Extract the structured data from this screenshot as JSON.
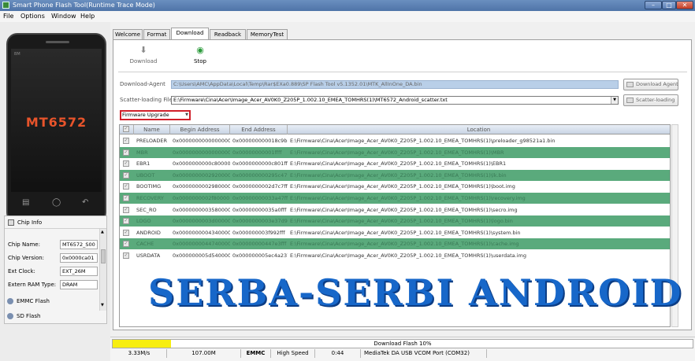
{
  "window": {
    "title": "Smart Phone Flash Tool(Runtime Trace Mode)"
  },
  "menu": [
    "File",
    "Options",
    "Window",
    "Help"
  ],
  "phone": {
    "brand": "BM",
    "chip": "MT6572"
  },
  "chip_info": {
    "title": "Chip Info",
    "rows": [
      {
        "label": "Chip Name:",
        "value": "MT6572_S00"
      },
      {
        "label": "Chip Version:",
        "value": "0x0000ca01"
      },
      {
        "label": "Ext Clock:",
        "value": "EXT_26M"
      },
      {
        "label": "Extern RAM Type:",
        "value": "DRAM"
      }
    ]
  },
  "side_sections": [
    "EMMC Flash",
    "SD Flash"
  ],
  "tabs": [
    "Welcome",
    "Format",
    "Download",
    "Readback",
    "MemoryTest"
  ],
  "toolbar": {
    "download": "Download",
    "stop": "Stop"
  },
  "download_agent": {
    "label": "Download-Agent",
    "value": "C:\\Users\\AMC\\AppData\\Local\\Temp\\Rar$EXa0.889\\SP Flash Tool v5.1352.01\\MTK_AllInOne_DA.bin",
    "button": "Download Agent"
  },
  "scatter": {
    "label": "Scatter-loading File",
    "value": "E:\\Firmware\\Cina\\Acer\\Image_Acer_AV0K0_Z205P_1.002.10_EMEA_TOMHRS(1)\\MT6572_Android_scatter.txt",
    "button": "Scatter-loading"
  },
  "mode": "Firmware Upgrade",
  "grid": {
    "headers": [
      "Name",
      "Begin Address",
      "End Address",
      "Location"
    ],
    "rows": [
      [
        "PRELOADER",
        "0x0000000000000000",
        "0x000000000018c9b",
        "E:\\Firmware\\Cina\\Acer\\Image_Acer_AV0K0_Z205P_1.002.10_EMEA_TOMHRS(1)\\preloader_g98521a1.bin"
      ],
      [
        "MBR",
        "0x0000000000000000",
        "0x00000000001ffff",
        "E:\\Firmware\\Cina\\Acer\\Image_Acer_AV0K0_Z205P_1.002.10_EMEA_TOMHRS(1)\\MBR"
      ],
      [
        "EBR1",
        "0x0000000000c80000",
        "0x0000000000c801ff",
        "E:\\Firmware\\Cina\\Acer\\Image_Acer_AV0K0_Z205P_1.002.10_EMEA_TOMHRS(1)\\EBR1"
      ],
      [
        "UBOOT",
        "0x0000000002920000",
        "0x000000000295c47f",
        "E:\\Firmware\\Cina\\Acer\\Image_Acer_AV0K0_Z205P_1.002.10_EMEA_TOMHRS(1)\\lk.bin"
      ],
      [
        "BOOTIMG",
        "0x0000000002980000",
        "0x0000000002d7c7ff",
        "E:\\Firmware\\Cina\\Acer\\Image_Acer_AV0K0_Z205P_1.002.10_EMEA_TOMHRS(1)\\boot.img"
      ],
      [
        "RECOVERY",
        "0x0000000002f80000",
        "0x00000000033a47ff",
        "E:\\Firmware\\Cina\\Acer\\Image_Acer_AV0K0_Z205P_1.002.10_EMEA_TOMHRS(1)\\recovery.img"
      ],
      [
        "SEC_RO",
        "0x0000000003580000",
        "0x00000000035a0fff",
        "E:\\Firmware\\Cina\\Acer\\Image_Acer_AV0K0_Z205P_1.002.10_EMEA_TOMHRS(1)\\secro.img"
      ],
      [
        "LOGO",
        "0x0000000003d00000",
        "0x0000000003e37d9f",
        "E:\\Firmware\\Cina\\Acer\\Image_Acer_AV0K0_Z205P_1.002.10_EMEA_TOMHRS(1)\\logo.bin"
      ],
      [
        "ANDROID",
        "0x0000000004340000",
        "0x000000003f992fff",
        "E:\\Firmware\\Cina\\Acer\\Image_Acer_AV0K0_Z205P_1.002.10_EMEA_TOMHRS(1)\\system.bin"
      ],
      [
        "CACHE",
        "0x0000000044740000",
        "0x00000000447e3fff",
        "E:\\Firmware\\Cina\\Acer\\Image_Acer_AV0K0_Z205P_1.002.10_EMEA_TOMHRS(1)\\cache.img"
      ],
      [
        "USRDATA",
        "0x000000005d540000",
        "0x000000005ec4a237",
        "E:\\Firmware\\Cina\\Acer\\Image_Acer_AV0K0_Z205P_1.002.10_EMEA_TOMHRS(1)\\userdata.img"
      ]
    ]
  },
  "watermark": "SERBA-SERBI ANDROID",
  "status": {
    "progress_label": "Download Flash 10%",
    "progress": 0.1,
    "speed": "3.33M/s",
    "size": "107.00M",
    "storage": "EMMC",
    "mode": "High Speed",
    "time": "0:44",
    "port": "MediaTek DA USB VCOM Port (COM32)"
  },
  "colors": {
    "highlight_row": "#5aaa7c",
    "progress_fill": "#f7ee10",
    "chip_text": "#e8542b",
    "watermark": "#1767c9"
  }
}
